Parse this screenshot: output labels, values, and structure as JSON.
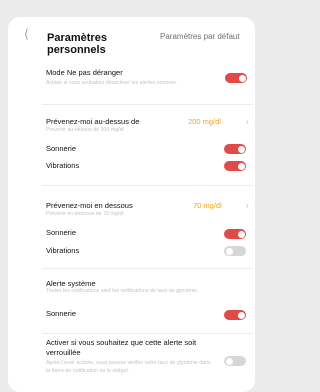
{
  "header": {
    "back_icon": "chevron-left-icon",
    "title": "Paramètres personnels",
    "defaults_link": "Paramètres par défaut"
  },
  "dnd": {
    "title": "Mode Ne pas déranger",
    "subtitle": "Activer si vous souhaitez désactiver les alertes sonores.",
    "on": true
  },
  "high": {
    "title": "Prévenez-moi au-dessus de",
    "subtitle": "Prévenir au-dessus de 200 mg/dl",
    "value": "200 mg/dl",
    "sound_label": "Sonnerie",
    "sound_on": true,
    "vibration_label": "Vibrations",
    "vibration_on": true
  },
  "low": {
    "title": "Prévenez-moi en dessous",
    "subtitle": "Prévenir en dessous de 70 mg/dl",
    "value": "70 mg/dl",
    "sound_label": "Sonnerie",
    "sound_on": true,
    "vibration_label": "Vibrations",
    "vibration_on": false
  },
  "system": {
    "title": "Alerte système",
    "subtitle": "Toutes les notifications sauf les notifications de taux de glycémie",
    "sound_label": "Sonnerie",
    "sound_on": true
  },
  "lock": {
    "title": "Activer si vous souhaitez que cette alerte soit verrouillée",
    "subtitle": "Après l'avoir activée, vous pouvez vérifier votre taux de glycémie dans la barre de notification ou le widget.",
    "on": false
  },
  "colors": {
    "toggle_on": "#e24a4a",
    "toggle_off": "#d6d6d6",
    "value_accent": "#f7a11a"
  }
}
